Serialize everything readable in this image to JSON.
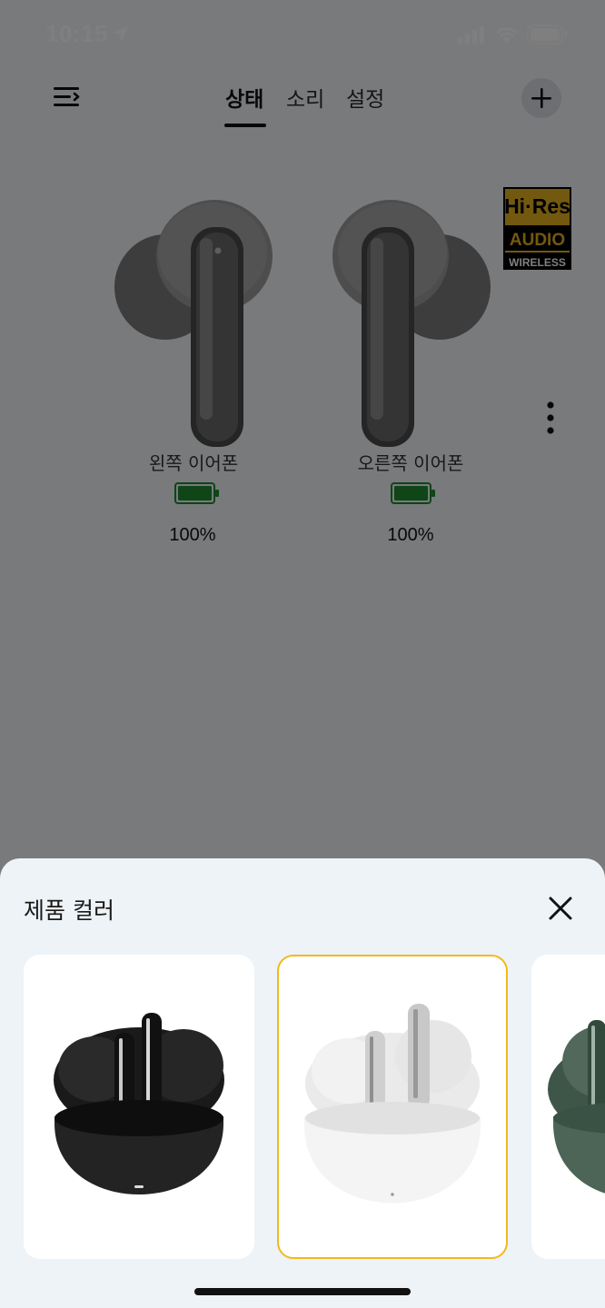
{
  "status_bar": {
    "time": "10:15"
  },
  "header": {
    "tabs": [
      {
        "label": "상태",
        "active": true
      },
      {
        "label": "소리",
        "active": false
      },
      {
        "label": "설정",
        "active": false
      }
    ]
  },
  "device": {
    "badge": {
      "line1": "Hi·Res",
      "line2": "AUDIO",
      "line3": "WIRELESS"
    },
    "left": {
      "label": "왼쪽 이어폰",
      "battery": "100%",
      "battery_level": 1.0
    },
    "right": {
      "label": "오른쪽 이어폰",
      "battery": "100%",
      "battery_level": 1.0
    }
  },
  "color_sheet": {
    "title": "제품 컬러",
    "options": [
      {
        "name": "black-earbuds",
        "selected": false
      },
      {
        "name": "white-earbuds",
        "selected": true
      },
      {
        "name": "green-earbuds",
        "selected": false
      }
    ]
  },
  "colors": {
    "accent": "#f5b81a",
    "battery_green": "#1f8a2e",
    "overlay": "rgba(0,0,0,0.5)"
  }
}
